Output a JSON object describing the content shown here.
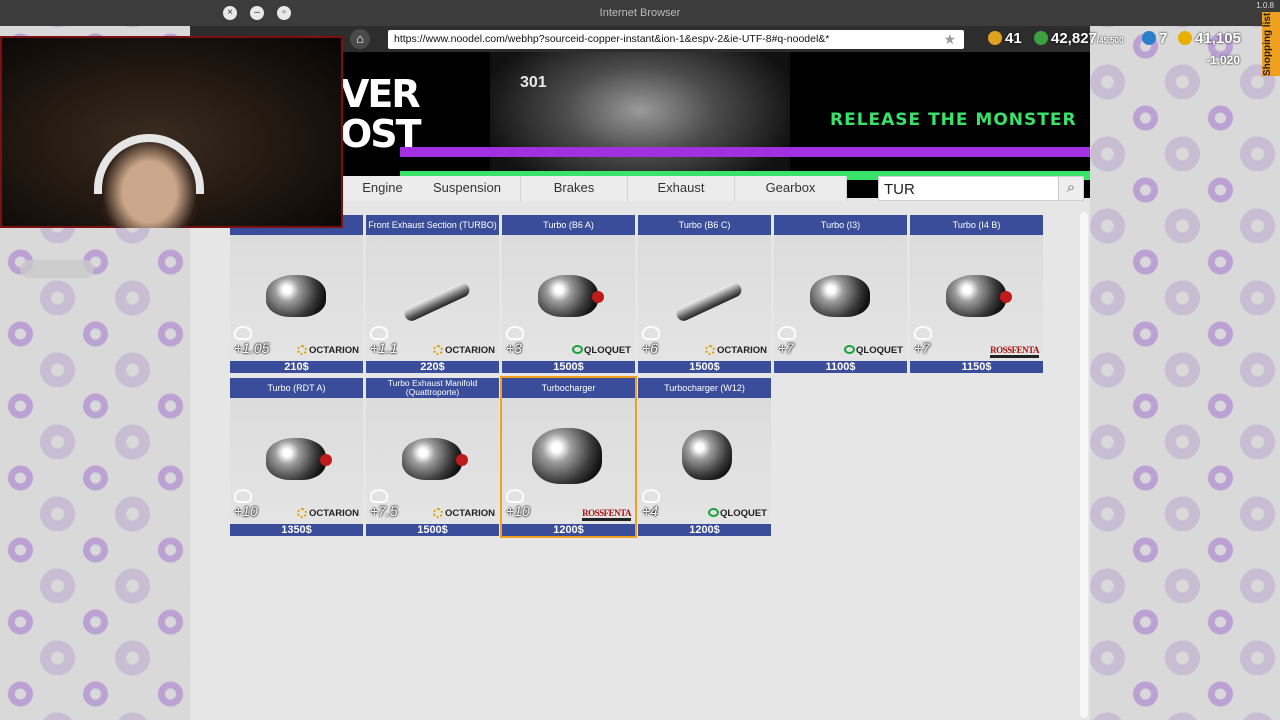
{
  "window": {
    "title": "Internet Browser",
    "version": "1.0.8"
  },
  "browser": {
    "url": "https://www.noodel.com/webhp?sourceid-copper-instant&ion-1&espv-2&ie-UTF-8#q-noodel&*"
  },
  "banner": {
    "logo_line1": "VER",
    "logo_line2": "OST",
    "engine_number": "301",
    "slogan": "RELEASE THE MONSTER"
  },
  "tabs": [
    "Engine",
    "Suspension",
    "Brakes",
    "Exhaust",
    "Gearbox"
  ],
  "search": {
    "value": "TUR"
  },
  "hud": {
    "level": "41",
    "xp": "42,827",
    "xp_sub": "/45,500",
    "keys": "7",
    "money": "41,105",
    "money_change": "-1,020",
    "shopping_list": "Shopping list"
  },
  "parts": [
    {
      "name": "",
      "hp": "+1.05",
      "brand": "OCTARION",
      "price": "210$"
    },
    {
      "name": "Front Exhaust Section (TURBO)",
      "hp": "+1.1",
      "brand": "OCTARION",
      "price": "220$"
    },
    {
      "name": "Turbo (B6 A)",
      "hp": "+3",
      "brand": "QLOQUET",
      "price": "1500$"
    },
    {
      "name": "Turbo (B6 C)",
      "hp": "+6",
      "brand": "OCTARION",
      "price": "1500$"
    },
    {
      "name": "Turbo (I3)",
      "hp": "+7",
      "brand": "QLOQUET",
      "price": "1100$"
    },
    {
      "name": "Turbo (I4 B)",
      "hp": "+7",
      "brand": "ROSSFENTA",
      "price": "1150$"
    },
    {
      "name": "Turbo (RDT A)",
      "hp": "+10",
      "brand": "OCTARION",
      "price": "1350$"
    },
    {
      "name": "Turbo Exhaust Manifold (Quattroporte)",
      "hp": "+7.5",
      "brand": "OCTARION",
      "price": "1500$"
    },
    {
      "name": "Turbocharger",
      "hp": "+10",
      "brand": "ROSSFENTA",
      "price": "1200$",
      "selected": true
    },
    {
      "name": "Turbocharger (W12)",
      "hp": "+4",
      "brand": "QLOQUET",
      "price": "1200$"
    }
  ],
  "colors": {
    "header_blue": "#3a4d9a",
    "accent_green": "#39e36a",
    "accent_purple": "#a030e0",
    "selected": "#f0a020"
  }
}
